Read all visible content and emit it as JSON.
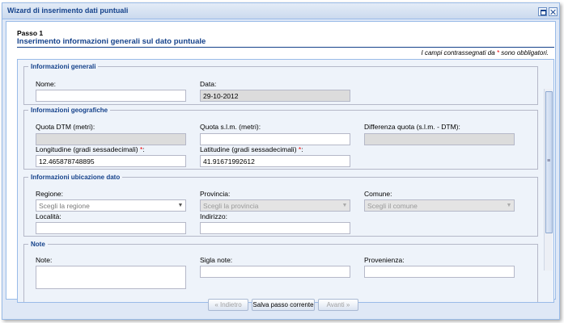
{
  "window": {
    "title": "Wizard di inserimento dati puntuali"
  },
  "step": {
    "title": "Passo 1",
    "subtitle": "Inserimento informazioni generali sul dato puntuale",
    "required_note_prefix": "I campi contrassegnati da",
    "required_note_star": "*",
    "required_note_suffix": "sono obbligatori."
  },
  "sections": {
    "generali": {
      "legend": "Informazioni generali",
      "nome_label": "Nome:",
      "nome_value": "",
      "data_label": "Data:",
      "data_value": "29-10-2012"
    },
    "geografiche": {
      "legend": "Informazioni geografiche",
      "quota_dtm_label": "Quota DTM (metri):",
      "quota_dtm_value": "",
      "quota_slm_label": "Quota s.l.m. (metri):",
      "quota_slm_value": "",
      "diff_quota_label": "Differenza quota (s.l.m. - DTM):",
      "diff_quota_value": "",
      "longitudine_label": "Longitudine (gradi sessadecimali)",
      "longitudine_value": "12.465878748895",
      "latitudine_label": "Latitudine (gradi sessadecimali)",
      "latitudine_value": "41.91671992612",
      "required_star": "*",
      "colon": ":"
    },
    "ubicazione": {
      "legend": "Informazioni ubicazione dato",
      "regione_label": "Regione:",
      "regione_placeholder": "Scegli la regione",
      "provincia_label": "Provincia:",
      "provincia_placeholder": "Scegli la provincia",
      "comune_label": "Comune:",
      "comune_placeholder": "Scegli il comune",
      "localita_label": "Località:",
      "localita_value": "",
      "indirizzo_label": "Indirizzo:",
      "indirizzo_value": ""
    },
    "note": {
      "legend": "Note",
      "note_label": "Note:",
      "note_value": "",
      "sigla_label": "Sigla note:",
      "sigla_value": "",
      "provenienza_label": "Provenienza:",
      "provenienza_value": ""
    }
  },
  "footer": {
    "back_label": "« Indietro",
    "save_label": "Salva passo corrente",
    "next_label": "Avanti »"
  },
  "icons": {
    "combo_arrow": "▼",
    "scroll_grip": "≡"
  },
  "colors": {
    "accent": "#15428b",
    "border": "#99bbe8",
    "panel_bg": "#dfe8f6",
    "required": "#ee0000"
  }
}
